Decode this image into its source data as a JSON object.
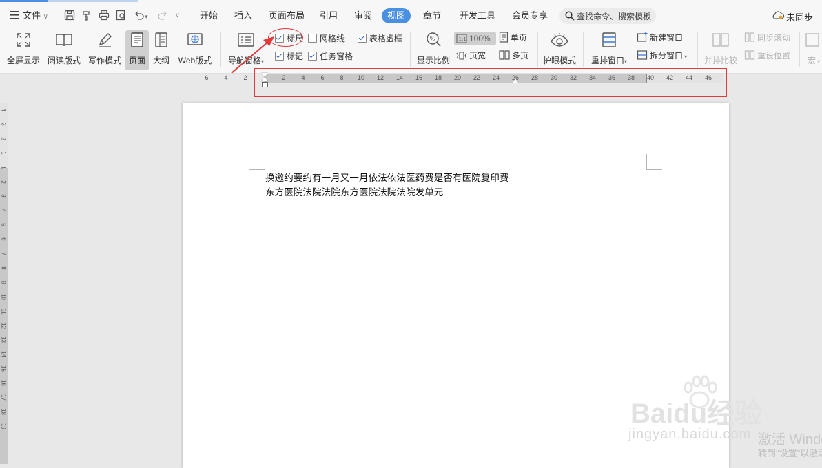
{
  "colors": {
    "accent": "#4a90e2",
    "annotation_red": "#e03a3a",
    "ruler_active": "#c8c8c8"
  },
  "menu": {
    "hamburger_icon": "hamburger-icon",
    "file_label": "文件",
    "tabs": [
      "开始",
      "插入",
      "页面布局",
      "引用",
      "审阅",
      "视图",
      "章节",
      "开发工具",
      "会员专享"
    ],
    "active_tab": "视图",
    "search_placeholder": "查找命令、搜索模板",
    "sync_label": "未同步"
  },
  "ribbon": {
    "fullscreen": "全屏显示",
    "reading": "阅读版式",
    "writing": "写作模式",
    "page": "页面",
    "outline": "大纲",
    "web": "Web版式",
    "nav_pane": "导航窗格",
    "checks": [
      {
        "label": "标尺",
        "checked": true
      },
      {
        "label": "网格线",
        "checked": false
      },
      {
        "label": "表格虚框",
        "checked": true
      },
      {
        "label": "标记",
        "checked": true
      },
      {
        "label": "任务窗格",
        "checked": true
      }
    ],
    "zoom_ratio": "显示比例",
    "zoom_value": "100%",
    "page_width": "页宽",
    "single_page": "单页",
    "multi_page": "多页",
    "eye_mode": "护眼模式",
    "rearrange": "重排窗口",
    "new_window": "新建窗口",
    "split_window": "拆分窗口",
    "side_by_side": "并排比较",
    "sync_scroll": "同步滚动",
    "reset_position": "重设位置",
    "macro": "宏"
  },
  "ruler": {
    "left_numbers": [
      "6",
      "4",
      "2"
    ],
    "numbers": [
      "2",
      "4",
      "6",
      "8",
      "10",
      "12",
      "14",
      "16",
      "18",
      "20",
      "22",
      "24",
      "26",
      "28",
      "30",
      "32",
      "34",
      "36",
      "38",
      "40",
      "42",
      "44",
      "46"
    ]
  },
  "vruler": {
    "numbers": [
      "4",
      "3",
      "2",
      "1",
      "1",
      "2",
      "3",
      "4",
      "5",
      "6",
      "7",
      "8",
      "9",
      "10",
      "11",
      "12",
      "13",
      "14",
      "15",
      "16",
      "17",
      "18",
      "19"
    ]
  },
  "document": {
    "line1": "换邀约要约有一月又一月依法依法医药费是否有医院复印费",
    "line2": "东方医院法院法院东方医院法院法院发单元"
  },
  "watermark": {
    "brand": "Baidu经验",
    "url": "jingyan.baidu.com",
    "activate": "激活 Windows",
    "activate_sub": "转到\"设置\"以激活"
  }
}
